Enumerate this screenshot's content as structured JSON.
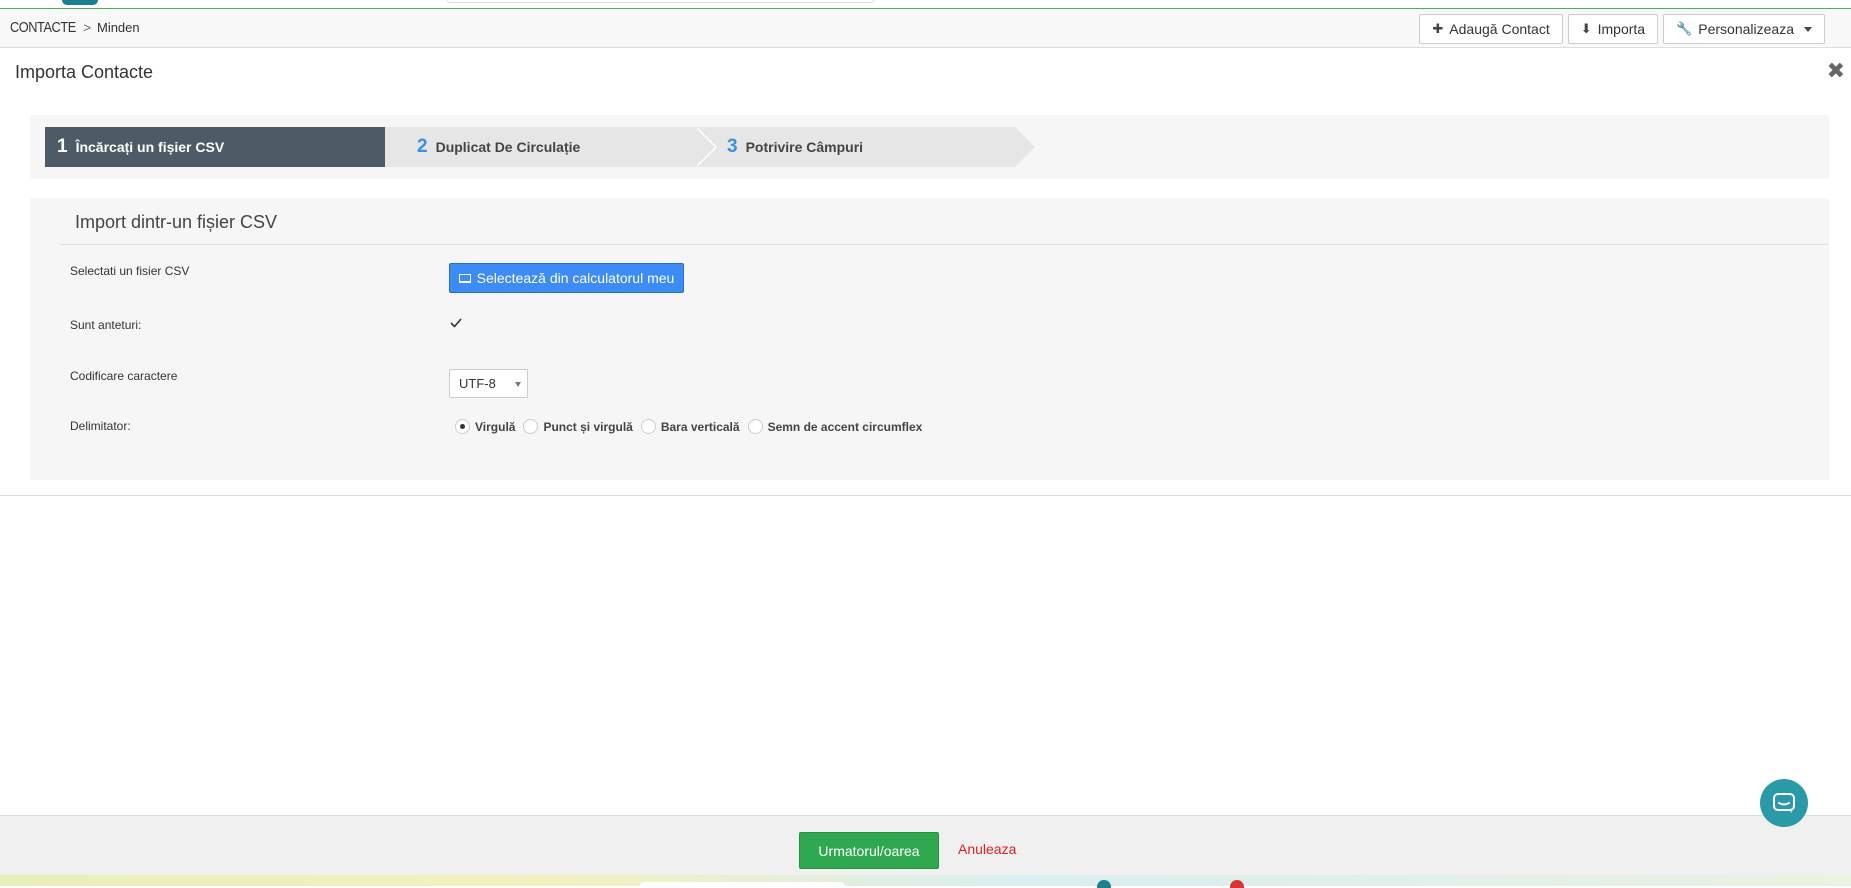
{
  "header": {
    "module": "CONTACTE",
    "separator": ">",
    "current": "Minden",
    "actions": [
      {
        "icon": "plus-icon",
        "label": "Adaugă Contact"
      },
      {
        "icon": "download-icon",
        "label": "Importa"
      },
      {
        "icon": "wrench-icon",
        "label": "Personalizeaza"
      }
    ]
  },
  "page": {
    "title": "Importa Contacte",
    "close": "✖"
  },
  "steps": [
    {
      "number": "1",
      "label": "Încărcați un fișier CSV",
      "active": true
    },
    {
      "number": "2",
      "label": "Duplicat De Circulație",
      "active": false
    },
    {
      "number": "3",
      "label": "Potrivire Câmpuri",
      "active": false
    }
  ],
  "form": {
    "title": "Import dintr-un fișier CSV",
    "file_label": "Selectati un fisier CSV",
    "file_button": "Selectează din calculatorul meu",
    "headers_label": "Sunt anteturi:",
    "headers_checked": true,
    "encoding_label": "Codificare caractere",
    "encoding_value": "UTF-8",
    "delimiter_label": "Delimitator:",
    "delimiters": [
      {
        "label": "Virgulă",
        "checked": true
      },
      {
        "label": "Punct și virgulă",
        "checked": false
      },
      {
        "label": "Bara verticală",
        "checked": false
      },
      {
        "label": "Semn de accent circumflex",
        "checked": false
      }
    ]
  },
  "footer": {
    "next": "Urmatorul/oarea",
    "cancel": "Anuleaza"
  },
  "colors": {
    "active_step": "#4e5b67",
    "step_number": "#3a8ee6",
    "primary_button": "#3d8bf5",
    "next_button": "#2fa84f",
    "cancel": "#e02020",
    "chat": "#2a9aa6"
  }
}
